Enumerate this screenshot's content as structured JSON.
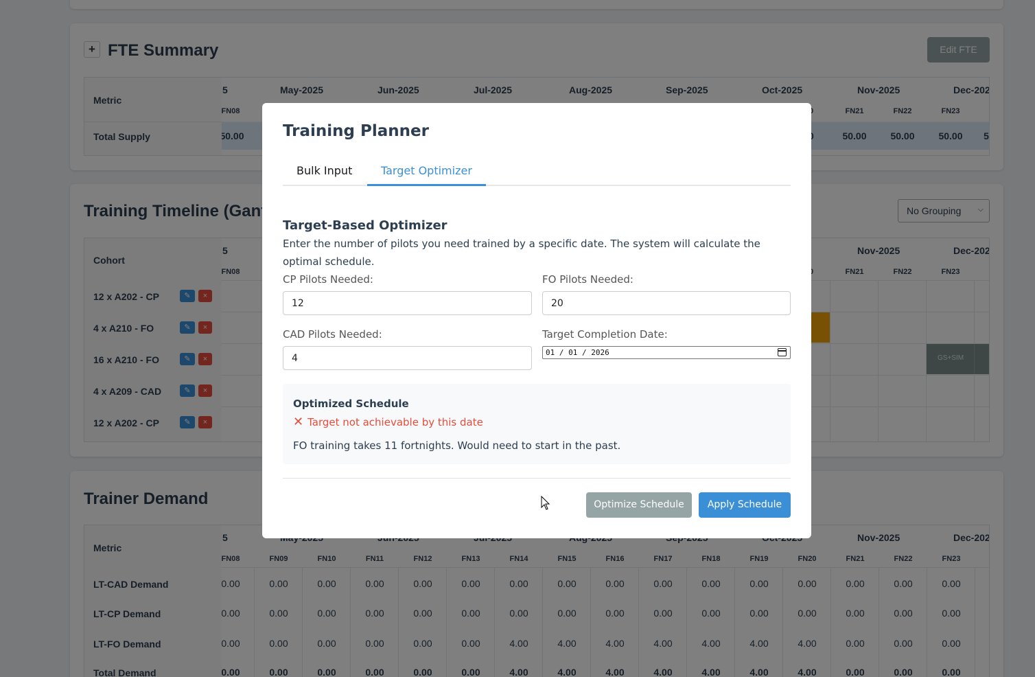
{
  "background": {
    "fte_summary": {
      "title": "FTE Summary",
      "toggle": "+",
      "edit_button": "Edit FTE",
      "metric_header": "Metric",
      "row_label": "Total Supply",
      "months": [
        "5",
        "May-2025",
        "Jun-2025",
        "Jul-2025",
        "Aug-2025",
        "Sep-2025",
        "Oct-2025",
        "Nov-2025",
        "Dec-202"
      ],
      "fn_left": "FN08",
      "fn_right": [
        "0",
        "FN21",
        "FN22",
        "FN23"
      ],
      "supply_left": "50.00",
      "supply_right": [
        "00",
        "50.00",
        "50.00",
        "50.00",
        "5"
      ]
    },
    "timeline": {
      "title": "Training Timeline (Gant",
      "grouping_select": "No Grouping",
      "cohort_header": "Cohort",
      "months_left": "5",
      "months_right": [
        "Nov-2025",
        "Dec-202"
      ],
      "fn_left": "FN08",
      "fn_right": [
        "0",
        "FN21",
        "FN22",
        "FN23"
      ],
      "cohorts": [
        "12 x A202 - CP",
        "4 x A210 - FO",
        "16 x A210 - FO",
        "4 x A209 - CAD",
        "12 x A202 - CP"
      ],
      "edit_icon": "✎",
      "delete_icon": "×",
      "gantt_bar_label": "GS+SIM"
    },
    "trainer_demand": {
      "title": "Trainer Demand",
      "metric_header": "Metric",
      "months": [
        "5",
        "May-2025",
        "Jun-2025",
        "Jul-2025",
        "Aug-2025",
        "Sep-2025",
        "Oct-2025",
        "Nov-2025",
        "Dec-202"
      ],
      "fortnights": [
        "FN08",
        "FN09",
        "FN10",
        "FN11",
        "FN12",
        "FN13",
        "FN14",
        "FN15",
        "FN16",
        "FN17",
        "FN18",
        "FN19",
        "FN20",
        "FN21",
        "FN22",
        "FN23"
      ],
      "rows": [
        {
          "label": "LT-CAD Demand",
          "values": [
            "0.00",
            "0.00",
            "0.00",
            "0.00",
            "0.00",
            "0.00",
            "0.00",
            "0.00",
            "0.00",
            "0.00",
            "0.00",
            "0.00",
            "0.00",
            "0.00",
            "0.00",
            "0.00"
          ]
        },
        {
          "label": "LT-CP Demand",
          "values": [
            "0.00",
            "0.00",
            "0.00",
            "0.00",
            "0.00",
            "0.00",
            "0.00",
            "0.00",
            "0.00",
            "0.00",
            "0.00",
            "0.00",
            "0.00",
            "0.00",
            "0.00",
            "0.00"
          ]
        },
        {
          "label": "LT-FO Demand",
          "values": [
            "0.00",
            "0.00",
            "0.00",
            "0.00",
            "0.00",
            "0.00",
            "4.00",
            "4.00",
            "4.00",
            "4.00",
            "4.00",
            "4.00",
            "4.00",
            "0.00",
            "0.00",
            "0.00"
          ]
        },
        {
          "label": "Total Demand",
          "values": [
            "0.00",
            "0.00",
            "0.00",
            "0.00",
            "0.00",
            "0.00",
            "4.00",
            "4.00",
            "4.00",
            "4.00",
            "4.00",
            "4.00",
            "4.00",
            "0.00",
            "0.00",
            "0.00"
          ]
        }
      ]
    }
  },
  "modal": {
    "title": "Training Planner",
    "tabs": [
      {
        "label": "Bulk Input",
        "active": false
      },
      {
        "label": "Target Optimizer",
        "active": true
      }
    ],
    "section_title": "Target-Based Optimizer",
    "description": "Enter the number of pilots you need trained by a specific date. The system will calculate the optimal schedule.",
    "fields": {
      "cp": {
        "label": "CP Pilots Needed:",
        "value": "12"
      },
      "fo": {
        "label": "FO Pilots Needed:",
        "value": "20"
      },
      "cad": {
        "label": "CAD Pilots Needed:",
        "value": "4"
      },
      "date": {
        "label": "Target Completion Date:",
        "value": "01 / 01 / 2026"
      }
    },
    "result": {
      "title": "Optimized Schedule",
      "status_icon": "✕",
      "status": "Target not achievable by this date",
      "message": "FO training takes 11 fortnights. Would need to start in the past."
    },
    "buttons": {
      "optimize": "Optimize Schedule",
      "apply": "Apply Schedule"
    }
  },
  "colors": {
    "accent": "#3a8fd6",
    "error": "#e74c3c",
    "gray_button": "#95a5a6",
    "gantt_orange": "#f0a30a",
    "gantt_gray": "#7f8c8d"
  }
}
